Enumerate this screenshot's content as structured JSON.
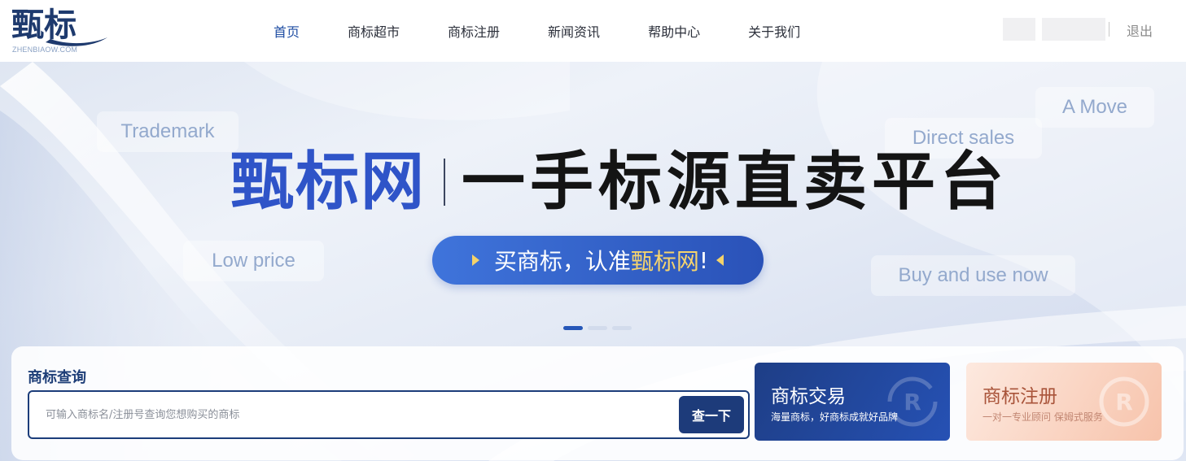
{
  "header": {
    "logo_text": "甄标",
    "logo_sub": "ZHENBIAOW.COM",
    "nav": [
      {
        "label": "首页"
      },
      {
        "label": "商标超市"
      },
      {
        "label": "商标注册"
      },
      {
        "label": "新闻资讯"
      },
      {
        "label": "帮助中心"
      },
      {
        "label": "关于我们"
      }
    ],
    "logout": "退出"
  },
  "banner": {
    "brand": "甄标网",
    "slogan": "一手标源直卖平台",
    "pill_prefix": "买商标，认准",
    "pill_highlight": "甄标网",
    "pill_suffix": "!",
    "tags": {
      "trademark": "Trademark",
      "low_price": "Low price",
      "direct_sales": "Direct sales",
      "a_move": "A Move",
      "buy_and_use": "Buy and use now"
    },
    "slides": 3,
    "active_slide": 1
  },
  "search": {
    "title": "商标查询",
    "placeholder": "可输入商标名/注册号查询您想购买的商标",
    "button": "查一下"
  },
  "cards": {
    "trade": {
      "title": "商标交易",
      "subtitle": "海量商标，好商标成就好品牌",
      "icon": "registered-refresh-icon"
    },
    "register": {
      "title": "商标注册",
      "subtitle": "一对一专业顾问 保姆式服务",
      "icon": "registered-icon"
    }
  },
  "colors": {
    "brand_blue": "#2f54c8",
    "nav_active": "#1f4ea3",
    "dark_blue": "#1d3b7a",
    "pill_gold": "#f6d46d"
  }
}
